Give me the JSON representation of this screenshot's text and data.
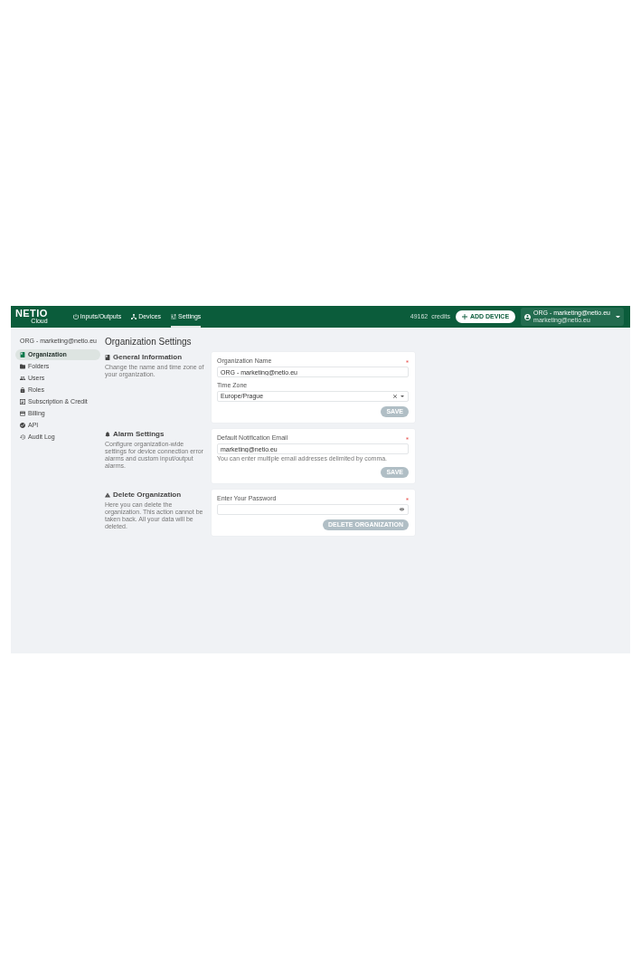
{
  "header": {
    "logo": {
      "wordmark": "NETIO",
      "subtitle": "Cloud"
    },
    "nav": [
      {
        "label": "Inputs/Outputs",
        "selected": false
      },
      {
        "label": "Devices",
        "selected": false
      },
      {
        "label": "Settings",
        "selected": true
      }
    ],
    "credits": {
      "amount": "49162",
      "unit": "credits"
    },
    "add_device_button": "ADD DEVICE",
    "account": {
      "name": "ORG - marketing@netio.eu",
      "email": "marketing@netio.eu"
    }
  },
  "sidebar": {
    "heading": "ORG - marketing@netio.eu",
    "items": [
      {
        "label": "Organization",
        "selected": true
      },
      {
        "label": "Folders",
        "selected": false
      },
      {
        "label": "Users",
        "selected": false
      },
      {
        "label": "Roles",
        "selected": false
      },
      {
        "label": "Subscription & Credit",
        "selected": false
      },
      {
        "label": "Billing",
        "selected": false
      },
      {
        "label": "API",
        "selected": false
      },
      {
        "label": "Audit Log",
        "selected": false
      }
    ]
  },
  "page_title": "Organization Settings",
  "sections": [
    {
      "title": "General Information",
      "description": "Change the name and time zone of your organization.",
      "fields": [
        {
          "kind": "text",
          "label": "Organization Name",
          "required": true,
          "value": "ORG - marketing@netio.eu"
        },
        {
          "kind": "select",
          "label": "Time Zone",
          "required": false,
          "value": "Europe/Prague"
        }
      ],
      "button": {
        "label": "SAVE",
        "disabled": true
      }
    },
    {
      "title": "Alarm Settings",
      "description": "Configure organization-wide settings for device connection error alarms and custom input/output alarms.",
      "fields": [
        {
          "kind": "text",
          "label": "Default Notification Email",
          "required": true,
          "value": "marketing@netio.eu",
          "hint": "You can enter multiple email addresses delimited by comma."
        }
      ],
      "button": {
        "label": "SAVE",
        "disabled": true
      }
    },
    {
      "title": "Delete Organization",
      "description": "Here you can delete the organization. This action cannot be taken back. All your data will be deleted.",
      "fields": [
        {
          "kind": "password",
          "label": "Enter Your Password",
          "required": true
        }
      ],
      "button": {
        "label": "DELETE ORGANIZATION",
        "disabled": true
      }
    }
  ]
}
